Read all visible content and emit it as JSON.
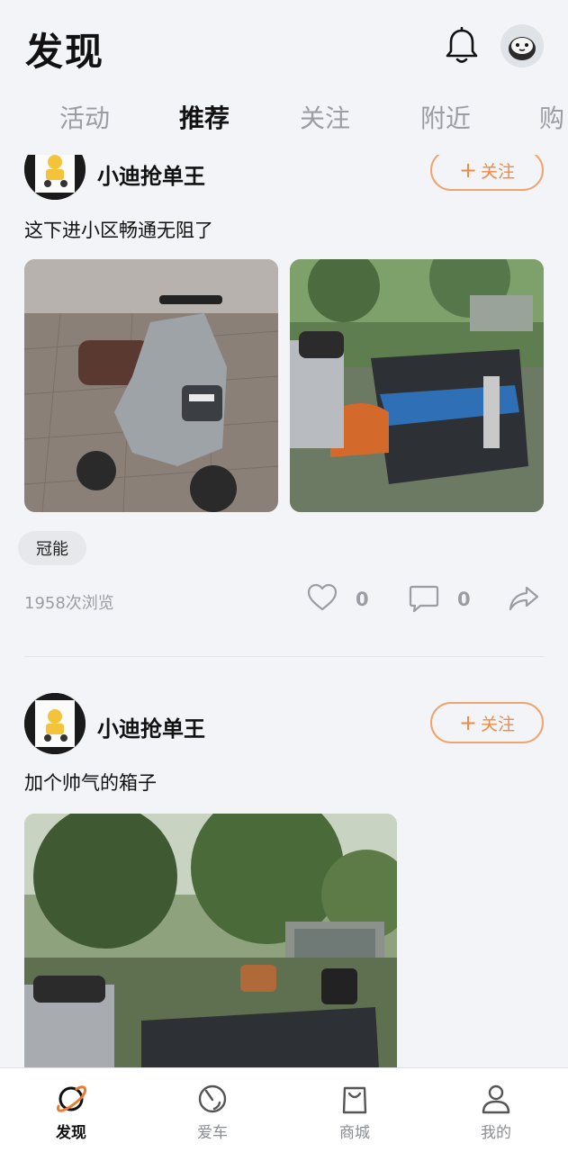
{
  "header": {
    "title": "发现"
  },
  "tabs": [
    {
      "label": "活动"
    },
    {
      "label": "推荐"
    },
    {
      "label": "关注"
    },
    {
      "label": "附近"
    },
    {
      "label": "购"
    }
  ],
  "active_tab": "推荐",
  "posts": [
    {
      "author": "小迪抢单王",
      "follow_label": "关注",
      "text": "这下进小区畅通无阻了",
      "tag": "冠能",
      "views": "1958次浏览",
      "likes": "0",
      "comments": "0"
    },
    {
      "author": "小迪抢单王",
      "follow_label": "关注",
      "text": "加个帅气的箱子"
    }
  ],
  "bottom_nav": [
    {
      "label": "发现",
      "icon": "planet-icon"
    },
    {
      "label": "爱车",
      "icon": "speedometer-icon"
    },
    {
      "label": "商城",
      "icon": "shopping-bag-icon"
    },
    {
      "label": "我的",
      "icon": "user-icon"
    }
  ],
  "colors": {
    "accent": "#ee8a44",
    "background": "#f3f4f8",
    "muted": "#9a9da3"
  }
}
